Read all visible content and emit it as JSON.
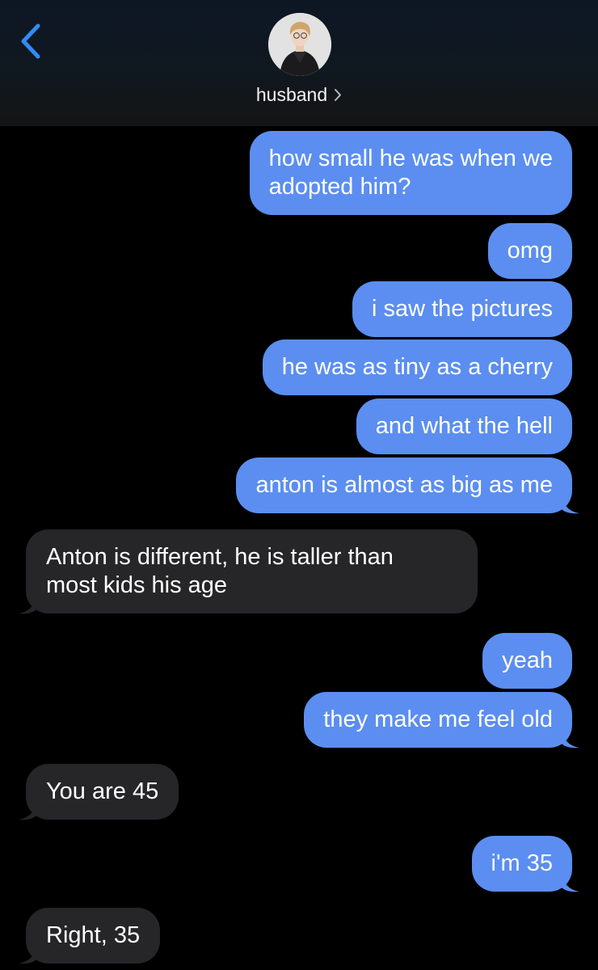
{
  "header": {
    "contact_name": "husband"
  },
  "colors": {
    "accent": "#2f8cf5",
    "sent_bubble": "#5b8ef0",
    "received_bubble": "#262628",
    "background": "#000000"
  },
  "icons": {
    "back": "chevron-left-icon",
    "contact_chevron": "chevron-right-icon"
  },
  "messages": [
    {
      "from": "me",
      "text_lines": [
        "how small he was when we",
        "adopted him?"
      ]
    },
    {
      "from": "me",
      "text": "omg"
    },
    {
      "from": "me",
      "text": "i saw the pictures"
    },
    {
      "from": "me",
      "text": "he was as tiny as a cherry"
    },
    {
      "from": "me",
      "text": "and what the hell"
    },
    {
      "from": "me",
      "text": "anton is almost as big as me"
    },
    {
      "from": "them",
      "text_lines": [
        "Anton is different, he is taller than",
        "most kids his age"
      ]
    },
    {
      "from": "me",
      "text": "yeah"
    },
    {
      "from": "me",
      "text": "they make me feel old"
    },
    {
      "from": "them",
      "text": "You are 45"
    },
    {
      "from": "me",
      "text": "i'm 35"
    },
    {
      "from": "them",
      "text": "Right, 35"
    }
  ]
}
